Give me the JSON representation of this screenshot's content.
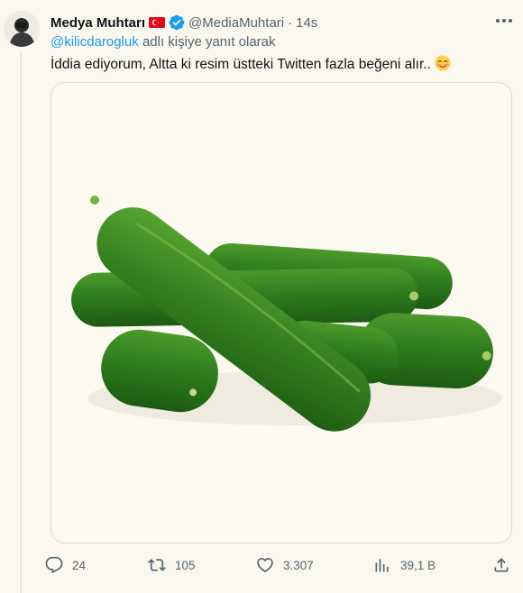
{
  "tweet": {
    "display_name": "Medya Muhtarı",
    "handle": "@MediaMuhtari",
    "time": "14s",
    "separator": "·",
    "reply_prefix_mention": "@kilicdarogluk",
    "reply_suffix": "adlı kişiye yanıt olarak",
    "text": "İddia ediyorum, Altta ki resim üstteki Twitten fazla beğeni alır..",
    "emoji": "smiling-face-with-blush",
    "media_description_icon": "cucumber-image"
  },
  "actions": {
    "replies": "24",
    "reposts": "105",
    "likes": "3.307",
    "views": "39,1 B"
  },
  "colors": {
    "accent": "#1d9bf0",
    "muted": "#536471",
    "verified": "#1d9bf0",
    "flag": "#e30a17"
  }
}
